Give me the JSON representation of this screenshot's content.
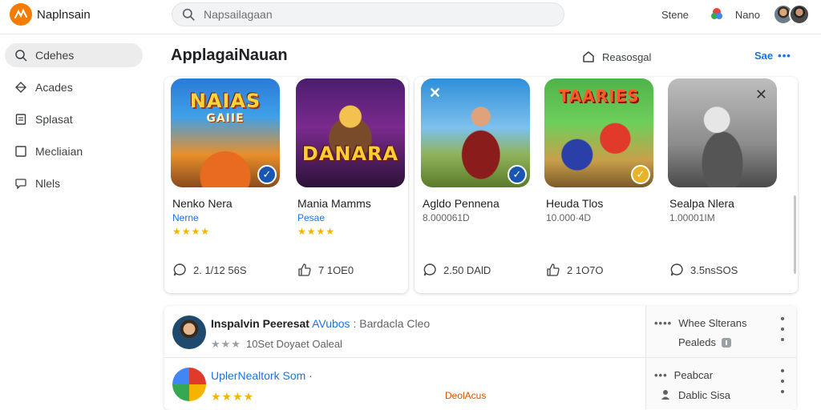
{
  "app": {
    "title": "Naplnsain"
  },
  "search": {
    "placeholder": "Napsailagaan"
  },
  "topbar": {
    "link": "Stene",
    "user_label": "Nano"
  },
  "sidebar": {
    "items": [
      {
        "label": "Cdehes",
        "icon": "search-icon",
        "active": true
      },
      {
        "label": "Acades",
        "icon": "diamond-icon",
        "active": false
      },
      {
        "label": "Splasat",
        "icon": "document-icon",
        "active": false
      },
      {
        "label": "Mecliaian",
        "icon": "square-icon",
        "active": false
      },
      {
        "label": "Nlels",
        "icon": "chat-icon",
        "active": false
      }
    ]
  },
  "main": {
    "section_title": "ApplagaiNauan",
    "featured_label": "Reasosgal",
    "see_more_label": "Sae",
    "see_more_dots": "•••"
  },
  "cards": [
    {
      "art_title": "NAIAS",
      "art_sub": "GAIIE",
      "name": "Nenko Nera",
      "subtitle": "Nerne",
      "rating": "★★★★",
      "stat": "2. 1/12 56S",
      "stat_icon": "chat-icon",
      "badge": true
    },
    {
      "art_title": "DANARA",
      "art_sub": "",
      "name": "Mania Mamms",
      "subtitle": "Pesae",
      "rating": "★★★★",
      "stat": "7 1OE0",
      "stat_icon": "thumbs-up-icon",
      "badge": false
    },
    {
      "art_title": "",
      "art_sub": "",
      "name": "Agldo Pennena",
      "subtitle": "8.000061D",
      "rating": "",
      "stat": "2.50 DAlD",
      "stat_icon": "chat-icon",
      "badge": true
    },
    {
      "art_title": "TAARIES",
      "art_sub": "",
      "name": "Heuda Tlos",
      "subtitle": "10.000·4D",
      "rating": "",
      "stat": "2 1O7O",
      "stat_icon": "thumbs-up-icon",
      "badge": true
    },
    {
      "art_title": "",
      "art_sub": "",
      "name": "Sealpa Nlera",
      "subtitle": "1.00001IM",
      "rating": "",
      "stat": "3.5nsSOS",
      "stat_icon": "chat-icon",
      "badge": false
    }
  ],
  "list": {
    "rows": [
      {
        "title_main": "Inspalvin Peeresat",
        "title_link": "AVubos",
        "title_rest": ": Bardacla Cleo",
        "stars": "★★★",
        "meta": "10Set Doyaet Oaleal",
        "right_line1": "Whee Slterans",
        "right_line2": "Pealeds",
        "right_dots": "••••",
        "mid_action": ""
      },
      {
        "title_main": "",
        "title_link": "UplerNealtork Som",
        "title_rest": "·",
        "stars": "★★★★",
        "meta": "",
        "right_line1": "Peabcar",
        "right_line2": "Dablic Sisa",
        "right_dots": "•••",
        "mid_action": "DeolAcus"
      }
    ]
  },
  "colors": {
    "accent": "#1a73e8",
    "brand": "#f57c00",
    "star": "#f4b400"
  }
}
